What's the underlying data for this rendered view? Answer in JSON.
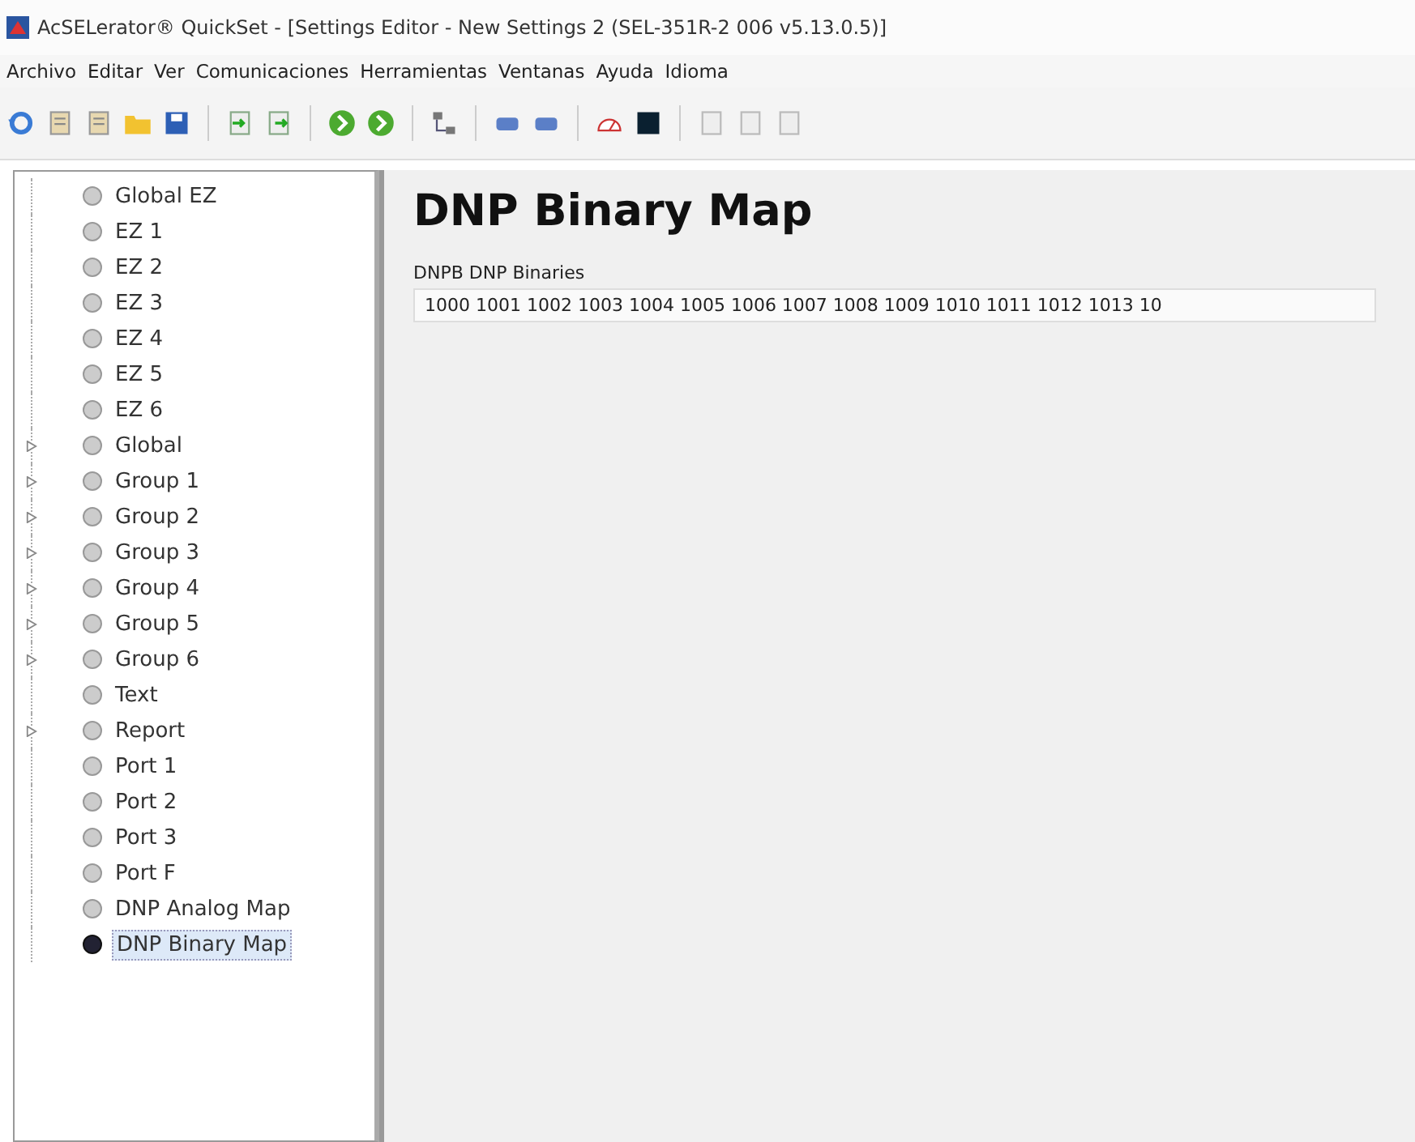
{
  "window": {
    "title": "AcSELerator® QuickSet - [Settings Editor - New Settings 2 (SEL-351R-2 006 v5.13.0.5)]"
  },
  "menu": [
    "Archivo",
    "Editar",
    "Ver",
    "Comunicaciones",
    "Herramientas",
    "Ventanas",
    "Ayuda",
    "Idioma"
  ],
  "toolbar": [
    {
      "kind": "refresh"
    },
    {
      "kind": "doc"
    },
    {
      "kind": "doc"
    },
    {
      "kind": "folder"
    },
    {
      "kind": "save"
    },
    {
      "kind": "sep"
    },
    {
      "kind": "import"
    },
    {
      "kind": "export"
    },
    {
      "kind": "sep"
    },
    {
      "kind": "go"
    },
    {
      "kind": "go"
    },
    {
      "kind": "sep"
    },
    {
      "kind": "network"
    },
    {
      "kind": "sep"
    },
    {
      "kind": "device"
    },
    {
      "kind": "device"
    },
    {
      "kind": "sep"
    },
    {
      "kind": "gauge"
    },
    {
      "kind": "terminal"
    },
    {
      "kind": "sep"
    },
    {
      "kind": "grey"
    },
    {
      "kind": "grey"
    },
    {
      "kind": "grey"
    }
  ],
  "tree": [
    {
      "label": "Global EZ",
      "kind": "leaf",
      "selected": false
    },
    {
      "label": "EZ 1",
      "kind": "leaf",
      "selected": false
    },
    {
      "label": "EZ 2",
      "kind": "leaf",
      "selected": false
    },
    {
      "label": "EZ 3",
      "kind": "leaf",
      "selected": false
    },
    {
      "label": "EZ 4",
      "kind": "leaf",
      "selected": false
    },
    {
      "label": "EZ 5",
      "kind": "leaf",
      "selected": false
    },
    {
      "label": "EZ 6",
      "kind": "leaf",
      "selected": false
    },
    {
      "label": "Global",
      "kind": "branch",
      "selected": false
    },
    {
      "label": "Group 1",
      "kind": "branch",
      "selected": false
    },
    {
      "label": "Group 2",
      "kind": "branch",
      "selected": false
    },
    {
      "label": "Group 3",
      "kind": "branch",
      "selected": false
    },
    {
      "label": "Group 4",
      "kind": "branch",
      "selected": false
    },
    {
      "label": "Group 5",
      "kind": "branch",
      "selected": false
    },
    {
      "label": "Group 6",
      "kind": "branch",
      "selected": false
    },
    {
      "label": "Text",
      "kind": "leaf",
      "selected": false
    },
    {
      "label": "Report",
      "kind": "branch",
      "selected": false
    },
    {
      "label": "Port 1",
      "kind": "leaf",
      "selected": false
    },
    {
      "label": "Port 2",
      "kind": "leaf",
      "selected": false
    },
    {
      "label": "Port 3",
      "kind": "leaf",
      "selected": false
    },
    {
      "label": "Port F",
      "kind": "leaf",
      "selected": false
    },
    {
      "label": "DNP Analog Map",
      "kind": "leaf",
      "selected": false
    },
    {
      "label": "DNP Binary Map",
      "kind": "leaf",
      "selected": true
    }
  ],
  "editor": {
    "heading": "DNP Binary Map",
    "field_label": "DNPB  DNP Binaries",
    "field_value": "1000 1001 1002 1003 1004 1005 1006 1007 1008 1009 1010 1011 1012 1013 10"
  }
}
